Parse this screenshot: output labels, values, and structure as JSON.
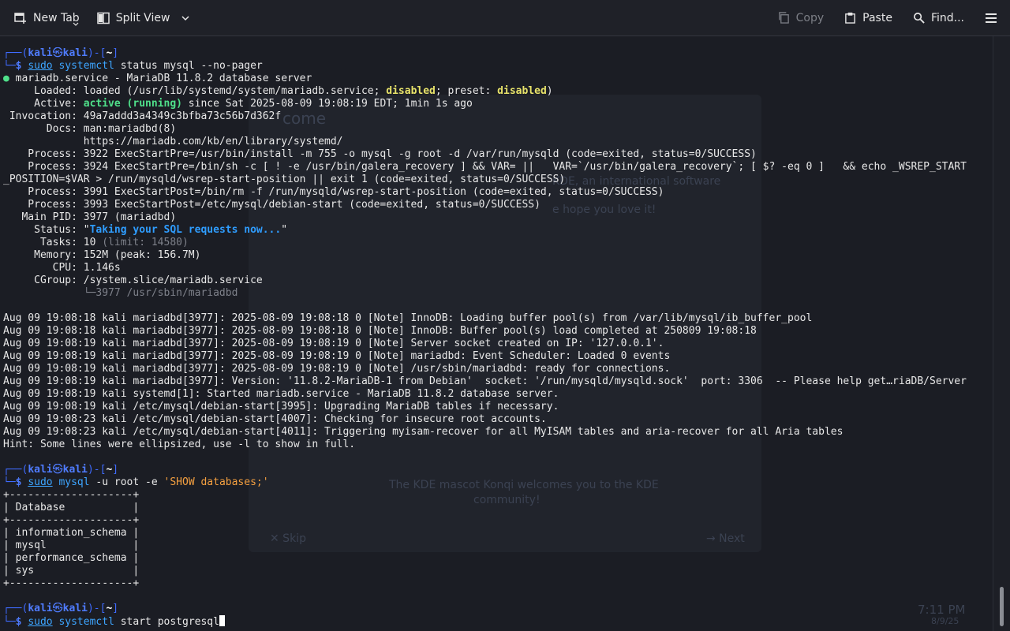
{
  "toolbar": {
    "new_tab": "New Tab",
    "split_view": "Split View",
    "copy": "Copy",
    "paste": "Paste",
    "find": "Find..."
  },
  "prompt": {
    "user": "kali",
    "host": "kali",
    "dir": "~"
  },
  "block1": {
    "cmd_sudo": "sudo",
    "cmd_name": "systemctl",
    "cmd_args": " status mysql --no-pager"
  },
  "status": {
    "service_line": " mariadb.service - MariaDB 11.8.2 database server",
    "loaded_a": "     Loaded: loaded (/usr/lib/systemd/system/mariadb.service; ",
    "loaded_disabled": "disabled",
    "loaded_b": "; preset: ",
    "loaded_c": ")",
    "active_a": "     Active: ",
    "active_state": "active (running)",
    "active_b": " since Sat 2025-08-09 19:08:19 EDT; 1min 1s ago",
    "invocation": " Invocation: 49a7addd3a4349c3bfba73c56b7d362f",
    "docs1": "       Docs: man:mariadbd(8)",
    "docs2": "             https://mariadb.com/kb/en/library/systemd/",
    "proc1": "    Process: 3922 ExecStartPre=/usr/bin/install -m 755 -o mysql -g root -d /var/run/mysqld (code=exited, status=0/SUCCESS)",
    "proc2a": "    Process: 3924 ExecStartPre=/bin/sh -c [ ! -e /usr/bin/galera_recovery ] && VAR= ||   VAR=`/usr/bin/galera_recovery`; [ $? -eq 0 ]   && echo _WSREP_START",
    "proc2b": "_POSITION=$VAR > /run/mysqld/wsrep-start-position || exit 1 (code=exited, status=0/SUCCESS)",
    "proc3": "    Process: 3991 ExecStartPost=/bin/rm -f /run/mysqld/wsrep-start-position (code=exited, status=0/SUCCESS)",
    "proc4": "    Process: 3993 ExecStartPost=/etc/mysql/debian-start (code=exited, status=0/SUCCESS)",
    "mainpid": "   Main PID: 3977 (mariadbd)",
    "status_a": "     Status: \"",
    "status_text": "Taking your SQL requests now...",
    "status_b": "\"",
    "tasks_a": "      Tasks: 10 ",
    "tasks_limit": "(limit: 14580)",
    "memory": "     Memory: 152M (peak: 156.7M)",
    "cpu": "        CPU: 1.146s",
    "cgroup": "     CGroup: /system.slice/mariadb.service",
    "cgroup_child": "             └─3977 /usr/sbin/mariadbd"
  },
  "logs": [
    "Aug 09 19:08:18 kali mariadbd[3977]: 2025-08-09 19:08:18 0 [Note] InnoDB: Loading buffer pool(s) from /var/lib/mysql/ib_buffer_pool",
    "Aug 09 19:08:18 kali mariadbd[3977]: 2025-08-09 19:08:18 0 [Note] InnoDB: Buffer pool(s) load completed at 250809 19:08:18",
    "Aug 09 19:08:19 kali mariadbd[3977]: 2025-08-09 19:08:19 0 [Note] Server socket created on IP: '127.0.0.1'.",
    "Aug 09 19:08:19 kali mariadbd[3977]: 2025-08-09 19:08:19 0 [Note] mariadbd: Event Scheduler: Loaded 0 events",
    "Aug 09 19:08:19 kali mariadbd[3977]: 2025-08-09 19:08:19 0 [Note] /usr/sbin/mariadbd: ready for connections.",
    "Aug 09 19:08:19 kali mariadbd[3977]: Version: '11.8.2-MariaDB-1 from Debian'  socket: '/run/mysqld/mysqld.sock'  port: 3306  -- Please help get…riaDB/Server",
    "Aug 09 19:08:19 kali systemd[1]: Started mariadb.service - MariaDB 11.8.2 database server.",
    "Aug 09 19:08:19 kali /etc/mysql/debian-start[3995]: Upgrading MariaDB tables if necessary.",
    "Aug 09 19:08:23 kali /etc/mysql/debian-start[4007]: Checking for insecure root accounts.",
    "Aug 09 19:08:23 kali /etc/mysql/debian-start[4011]: Triggering myisam-recover for all MyISAM tables and aria-recover for all Aria tables",
    "Hint: Some lines were ellipsized, use -l to show in full."
  ],
  "block2": {
    "cmd_sudo": "sudo",
    "cmd_name": "mysql",
    "cmd_args_a": " -u root -e ",
    "cmd_str": "'SHOW databases;'"
  },
  "table": {
    "border": "+--------------------+",
    "header": "| Database           |",
    "rows": [
      "| information_schema |",
      "| mysql              |",
      "| performance_schema |",
      "| sys                |"
    ]
  },
  "block3": {
    "cmd_sudo": "sudo",
    "cmd_name": "systemctl",
    "cmd_args": " start postgresql"
  },
  "background": {
    "welcome": "come",
    "line1": "KDE, an international software",
    "line2": "e hope you love it!",
    "mascot": "The KDE mascot Konqi welcomes you to the KDE",
    "mascot2": "community!",
    "skip": "✕ Skip",
    "next": "→ Next",
    "clock": "7:11 PM",
    "date": "8/9/25"
  }
}
